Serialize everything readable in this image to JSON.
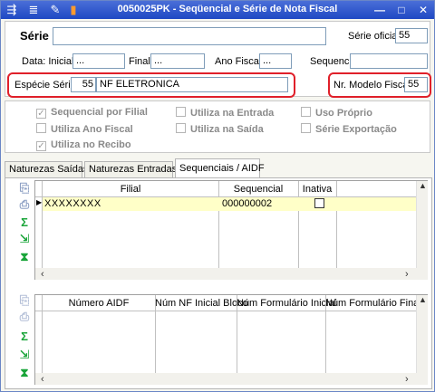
{
  "window": {
    "title": "0050025PK - Seqüencial e Série de Nota Fiscal",
    "controls": [
      "—",
      "□",
      "✕"
    ]
  },
  "serie": {
    "label": "Série",
    "value": "",
    "oficial_label": "Série oficial",
    "oficial_value": "55"
  },
  "dates": {
    "inicial_label": "Data: Inicial",
    "inicial_value": "...",
    "final_label": "Final",
    "final_value": "...",
    "ano_label": "Ano Fiscal:",
    "ano_value": "...",
    "sequencial_label": "Sequencial:",
    "sequencial_value": ""
  },
  "especie": {
    "label": "Espécie Série:",
    "code": "55",
    "name": "NF ELETRONICA"
  },
  "modelo": {
    "label": "Nr. Modelo Fiscal:",
    "value": "55"
  },
  "checks": [
    {
      "label": "Sequencial por Filial",
      "checked": true
    },
    {
      "label": "Utiliza Ano Fiscal",
      "checked": false
    },
    {
      "label": "Utiliza no Recibo",
      "checked": true
    },
    {
      "label": "Utiliza na Entrada",
      "checked": false
    },
    {
      "label": "Utiliza na Saída",
      "checked": false
    },
    {
      "label": "Uso Próprio",
      "checked": false
    },
    {
      "label": "Série Exportação",
      "checked": false
    }
  ],
  "tabs": [
    {
      "label": "Naturezas Saídas"
    },
    {
      "label": "Naturezas Entradas"
    },
    {
      "label": "Sequenciais / AIDF"
    }
  ],
  "grid1": {
    "columns": [
      "Filial",
      "Sequencial",
      "Inativa"
    ],
    "rows": [
      {
        "filial": "XXXXXXXX",
        "sequencial": "000000002",
        "inativa": false
      }
    ]
  },
  "grid2": {
    "columns": [
      "Número AIDF",
      "Núm NF Inicial Bloco",
      "Núm Formulário Inicial",
      "Núm Formulário Final"
    ]
  },
  "colors": {
    "titlebar": "#1f48c4",
    "highlight_row": "#ffffc8",
    "callout": "#e0202a",
    "icon_green": "#1aa53a"
  }
}
